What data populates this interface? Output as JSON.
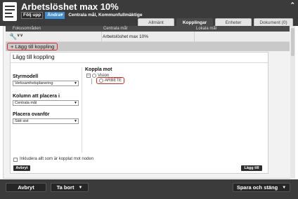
{
  "header": {
    "title": "Arbetslöshet max 10%",
    "tags": [
      "Följ upp",
      "Ändra"
    ],
    "subtitle": "Centrala mål, Kommunfullmäktige"
  },
  "tabs": [
    {
      "label": "Allmänt",
      "active": false
    },
    {
      "label": "Kopplingar",
      "active": true
    },
    {
      "label": "Enheter",
      "active": false
    },
    {
      "label": "Dokument (0)",
      "active": false
    }
  ],
  "table": {
    "headers": [
      "Fokusområden",
      "Centrala mål",
      "Lokala mål"
    ],
    "rows": [
      {
        "centrala_mal": "Arbetslöshet max 10%"
      }
    ]
  },
  "add_link_button": "+ Lägg till koppling",
  "form": {
    "title": "Lägg till koppling",
    "styrmodell": {
      "label": "Styrmodell",
      "value": "Verksamhetsplanering"
    },
    "kolumn": {
      "label": "Kolumn att placera i",
      "value": "Centrala mål"
    },
    "placera": {
      "label": "Placera ovanför",
      "value": "Sätt sist"
    },
    "koppla_mot": {
      "label": "Koppla mot",
      "tree_root": "Vision",
      "tree_child": "ARBETE"
    },
    "include_checkbox": "Inkludera allt som är kopplat mot noden",
    "cancel": "Avbryt",
    "add": "Lägg till"
  },
  "footer": {
    "cancel": "Avbryt",
    "delete": "Ta bort",
    "save_close": "Spara och stäng"
  },
  "colors": {
    "header_bg": "#3b3b3b",
    "active_tab": "#4b4b4b",
    "highlight": "#e02828",
    "accent_blue": "#3d8fd1"
  }
}
